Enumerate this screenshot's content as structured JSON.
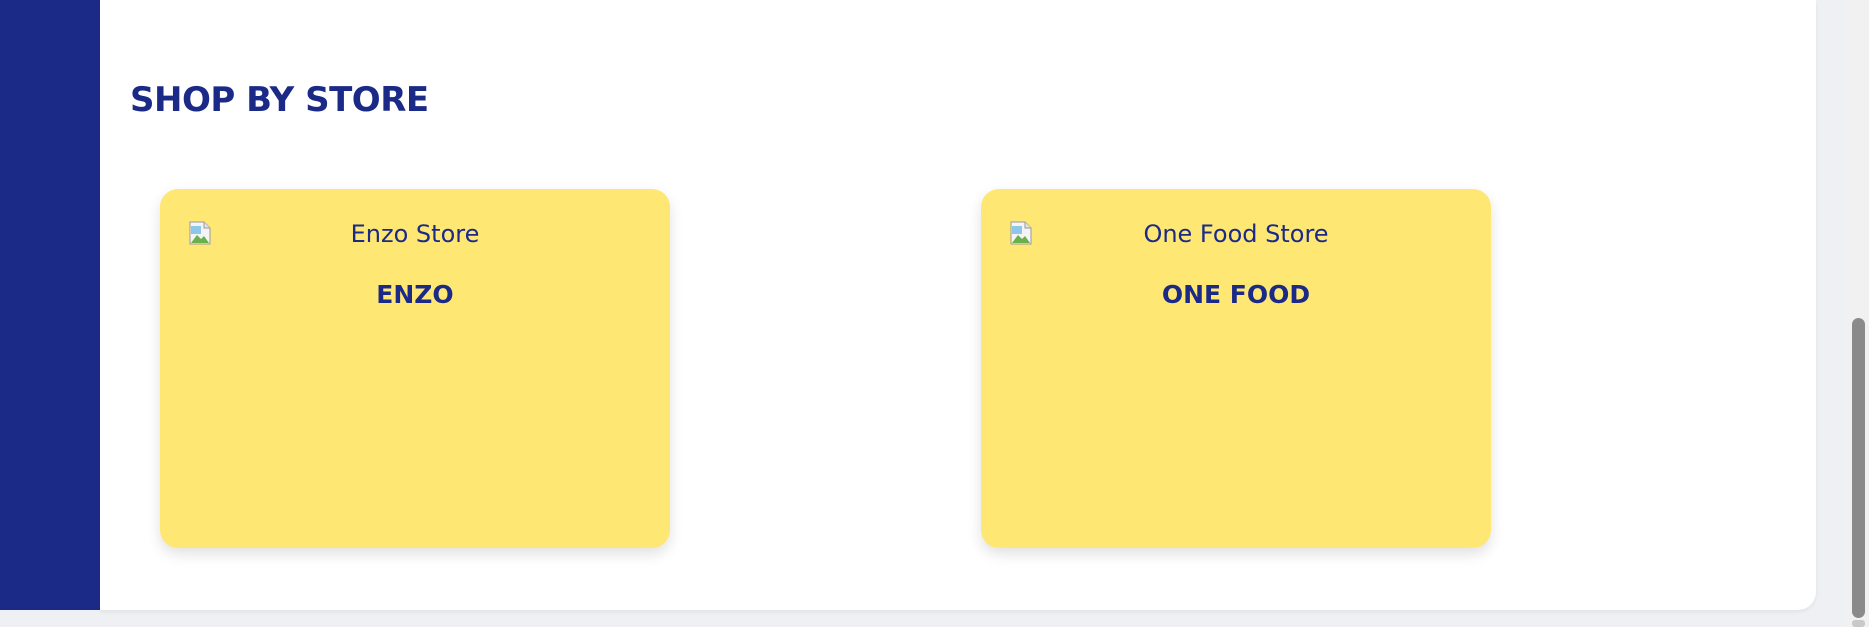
{
  "section": {
    "title": "SHOP BY STORE"
  },
  "stores": [
    {
      "image_alt": "Enzo Store",
      "name": "ENZO"
    },
    {
      "image_alt": "One Food Store",
      "name": "ONE FOOD"
    }
  ],
  "icons": {
    "broken_image": "broken-image-icon"
  },
  "colors": {
    "brand_navy": "#1b2a87",
    "card_yellow": "#ffe774",
    "panel_white": "#ffffff"
  }
}
